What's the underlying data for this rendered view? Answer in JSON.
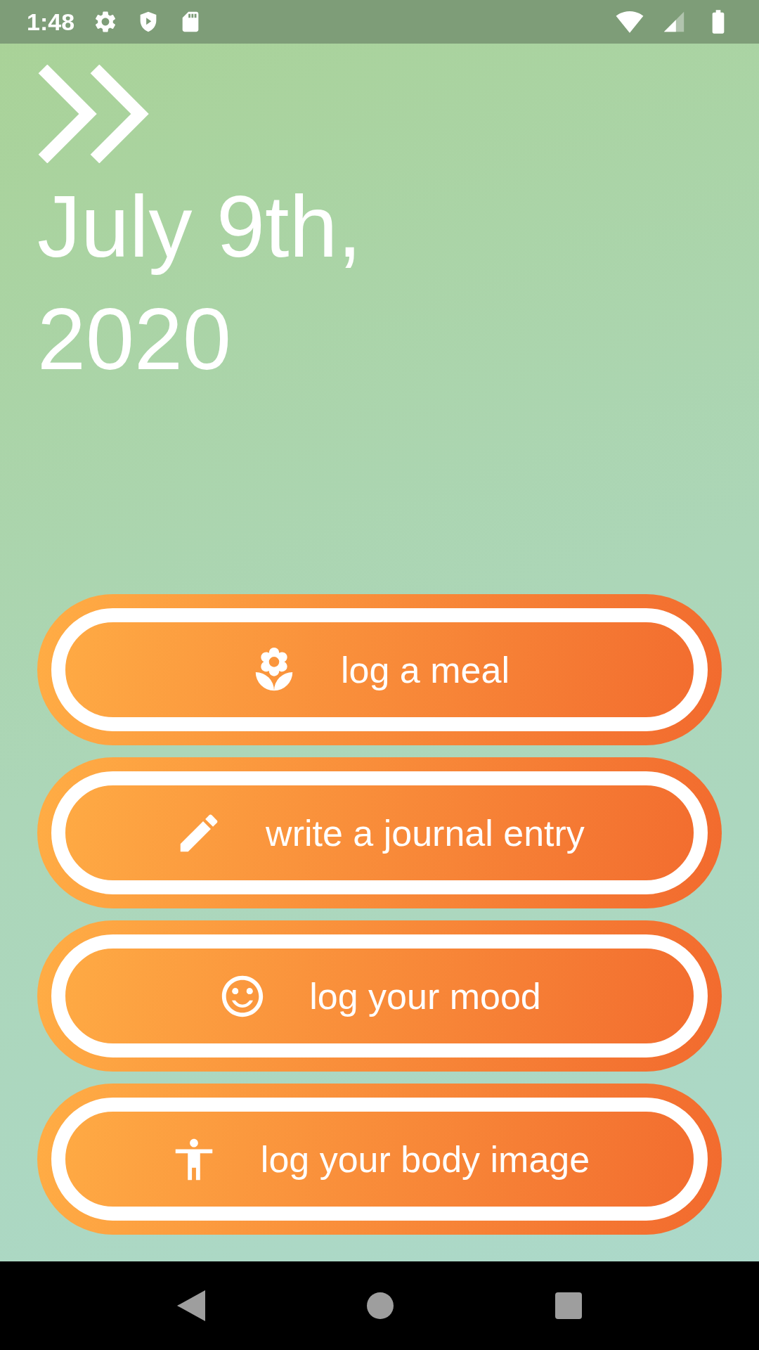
{
  "status_bar": {
    "time": "1:48"
  },
  "date": {
    "line_1": "July 9th,",
    "line_2": "2020"
  },
  "actions": [
    {
      "label": "log a meal"
    },
    {
      "label": "write a journal entry"
    },
    {
      "label": "log your mood"
    },
    {
      "label": "log your body image"
    }
  ]
}
